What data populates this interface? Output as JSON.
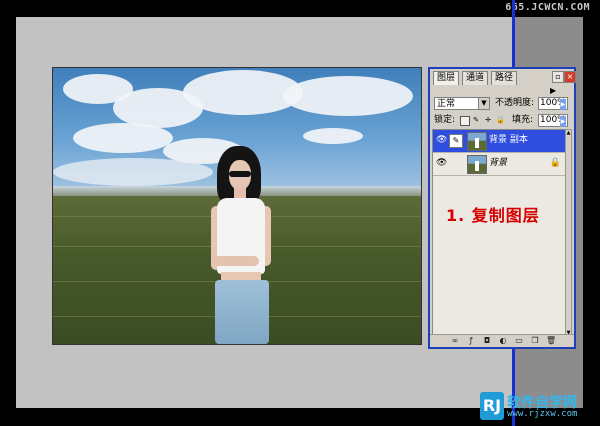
{
  "watermark_top": "665.JCWCN.COM",
  "colors": {
    "panel_border": "#1f3fb8",
    "selected_layer": "#2f4ee0",
    "annotation_red": "#d60000"
  },
  "layers_panel": {
    "tabs": [
      "图层",
      "通道",
      "路径"
    ],
    "blend_mode": "正常",
    "opacity_label": "不透明度:",
    "opacity_value": "100%",
    "lock_label": "锁定:",
    "fill_label": "填充:",
    "fill_value": "100%",
    "layers": [
      {
        "name": "背景 副本",
        "selected": true
      },
      {
        "name": "背景",
        "selected": false,
        "locked": true
      }
    ],
    "footer_icons": [
      "link-icon",
      "layer-style-icon",
      "mask-icon",
      "adjustment-icon",
      "group-icon",
      "new-layer-icon",
      "trash-icon"
    ]
  },
  "annotation": "1. 复制图层",
  "logo": {
    "mark": "RJ",
    "name": "软件自学网",
    "url": "www.rjzxw.com"
  }
}
